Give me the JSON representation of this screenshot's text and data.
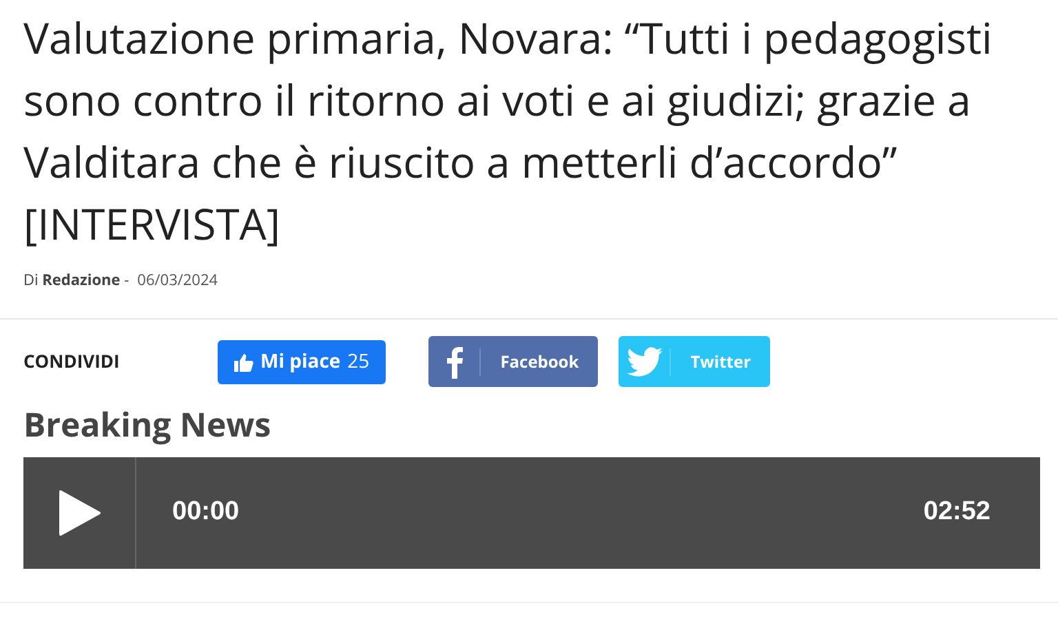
{
  "article": {
    "title": "Valutazione primaria, Novara: “Tutti i pedagogisti sono contro il ritorno ai voti e ai giudizi; grazie a Valditara che è riuscito a metterli d’accordo” [INTERVISTA]",
    "byline": "Di **Redazione** -",
    "date": "06/03/2024"
  },
  "share": {
    "label": "CONDIVIDI",
    "like": {
      "label": "Mi piace",
      "count": "25"
    },
    "buttons": [
      {
        "kind": "facebook",
        "label": "Facebook"
      },
      {
        "kind": "twitter",
        "label": "Twitter"
      }
    ]
  },
  "section_title": "Breaking News",
  "player": {
    "current_time": "00:00",
    "duration": "02:52"
  }
}
